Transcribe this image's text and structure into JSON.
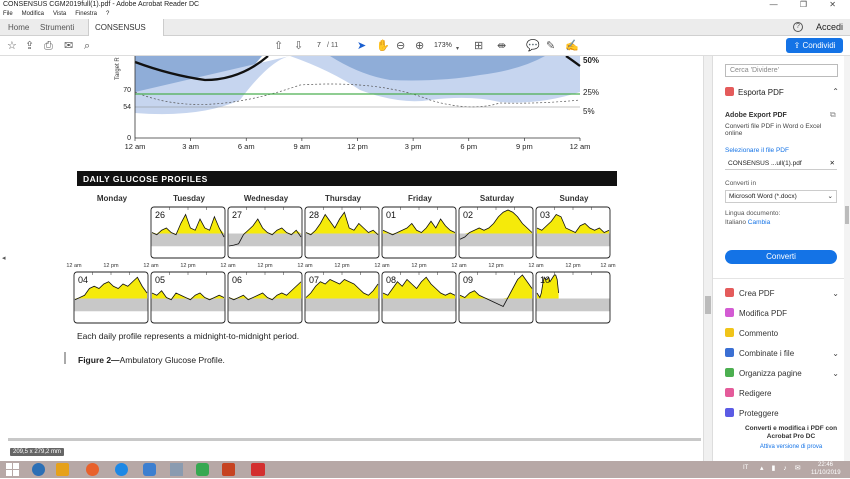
{
  "window": {
    "title": "CONSENSUS CGM2019full(1).pdf - Adobe Acrobat Reader DC",
    "controls": "— ❐ ✕"
  },
  "menu": [
    "File",
    "Modifica",
    "Vista",
    "Finestra",
    "?"
  ],
  "tabs": {
    "home": "Home",
    "tools": "Strumenti",
    "doc": "CONSENSUS CGM...",
    "signin": "Accedi"
  },
  "toolbar": {
    "page_current": "7",
    "page_total": "/ 11",
    "zoom": "173%",
    "share": "Condividi"
  },
  "chart_top": {
    "x_ticks": [
      "12 am",
      "3 am",
      "6 am",
      "9 am",
      "12 pm",
      "3 pm",
      "6 pm",
      "9 pm",
      "12 am"
    ],
    "y_ticks": [
      "70",
      "54",
      "0"
    ],
    "y_label_partial": "Target R",
    "right_labels": [
      "50%",
      "25%",
      "5%"
    ]
  },
  "daily": {
    "heading": "DAILY GLUCOSE PROFILES",
    "days": [
      "Monday",
      "Tuesday",
      "Wednesday",
      "Thursday",
      "Friday",
      "Saturday",
      "Sunday"
    ],
    "week1_dates": [
      "",
      "26",
      "27",
      "28",
      "01",
      "02",
      "03"
    ],
    "week2_dates": [
      "04",
      "05",
      "06",
      "07",
      "08",
      "09",
      "10"
    ],
    "axis_ticks": [
      "12 am",
      "12 pm"
    ],
    "axis_ticks_last": [
      "12 am",
      "12 pm",
      "12 am"
    ],
    "caption": "Each daily profile represents a midnight-to-midnight period."
  },
  "figure": {
    "label": "Figure 2—",
    "text": "Ambulatory Glucose Profile."
  },
  "status": {
    "dimensions": "209,5 x 279,2 mm"
  },
  "panel": {
    "search_placeholder": "Cerca 'Dividere'",
    "export_header": "Esporta PDF",
    "adobe_export": "Adobe Export PDF",
    "export_desc": "Converti file PDF in Word o Excel online",
    "select_file": "Selezionare il file PDF",
    "file_name": "CONSENSUS ...ull(1).pdf",
    "convert_to": "Converti in",
    "format": "Microsoft Word (*.docx)",
    "lang_label": "Lingua documento:",
    "lang_value": "Italiano",
    "lang_change": "Cambia",
    "convert_button": "Converti",
    "tools": [
      "Crea PDF",
      "Modifica PDF",
      "Commento",
      "Combinate i file",
      "Organizza pagine",
      "Redigere",
      "Proteggere"
    ],
    "promo": "Converti e modifica i PDF con Acrobat Pro DC",
    "trial": "Attiva versione di prova"
  },
  "taskbar": {
    "lang": "IT",
    "time": "22:46",
    "date": "11/10/2019"
  },
  "colors": {
    "accent": "#1473e6",
    "glucose_high": "#f5ea0a",
    "glucose_low": "#c0101a",
    "target_band": "#c8c8c8",
    "band_outer": "#c6d5ef",
    "band_inner": "#8fadd8"
  }
}
